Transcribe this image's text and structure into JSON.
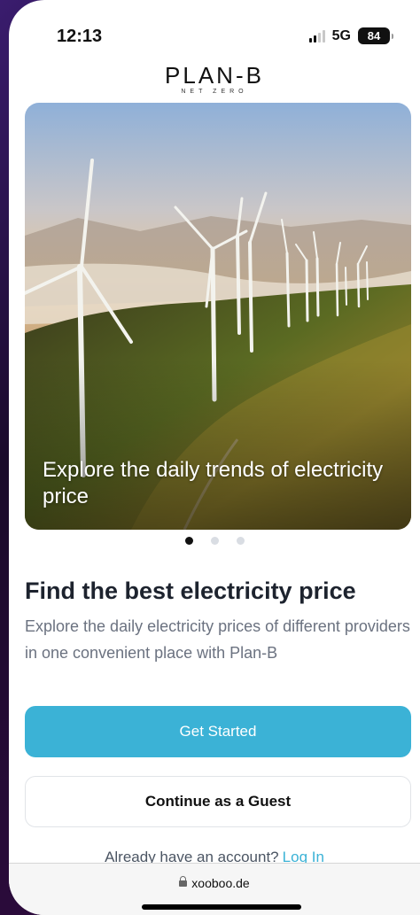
{
  "status_bar": {
    "time": "12:13",
    "network": "5G",
    "battery": "84"
  },
  "logo": {
    "main": "PLAN-B",
    "sub": "NET ZERO"
  },
  "carousel": {
    "caption": "Explore the daily trends of electricity price",
    "slide_count": 3,
    "active_index": 0
  },
  "main": {
    "heading": "Find the best electricity price",
    "description": "Explore the daily electricity prices of different providers in one convenient place with Plan-B"
  },
  "buttons": {
    "get_started": "Get Started",
    "guest": "Continue as a Guest"
  },
  "login": {
    "prompt": "Already have an account?",
    "link": "Log In"
  },
  "browser": {
    "url": "xooboo.de"
  },
  "colors": {
    "accent": "#3bb2d6",
    "heading": "#1d232e",
    "body_text": "#6b7280"
  }
}
